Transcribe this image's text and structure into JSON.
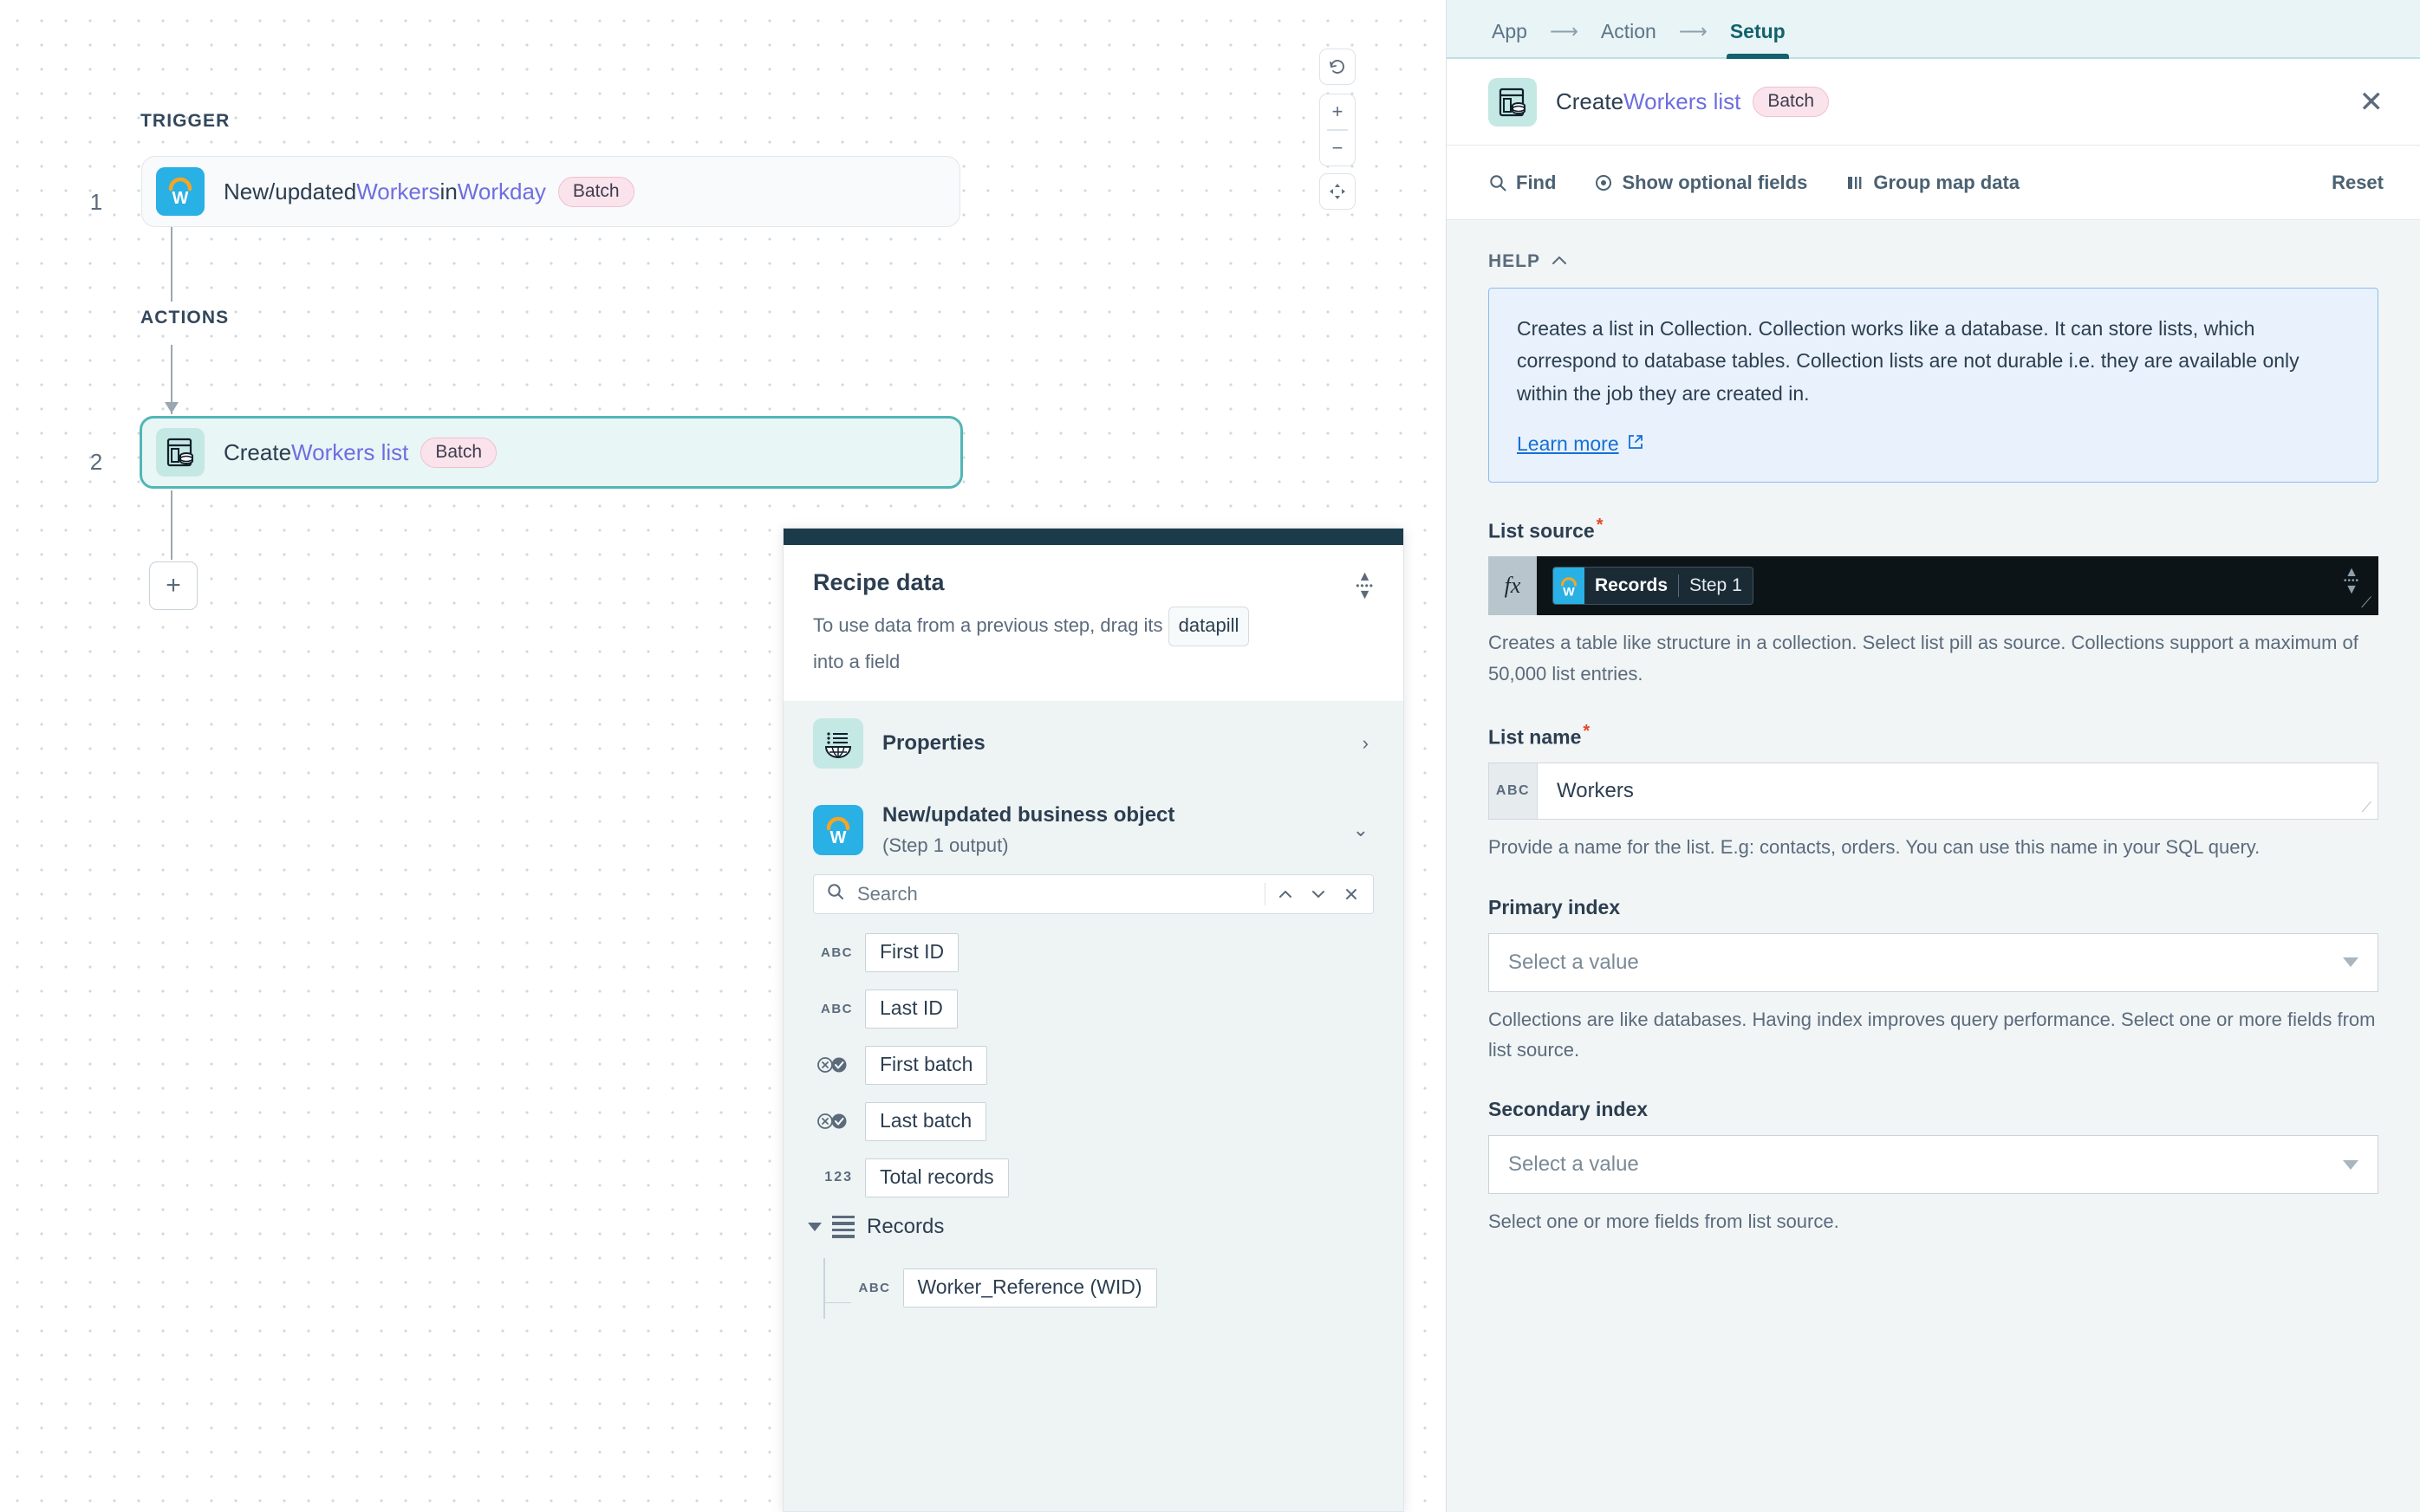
{
  "canvas": {
    "trigger_label": "TRIGGER",
    "actions_label": "ACTIONS",
    "step1": {
      "number": "1",
      "text_pre": "New/updated ",
      "accent1": "Workers",
      "text_mid": " in ",
      "accent2": "Workday",
      "badge": "Batch",
      "icon": "workday-icon"
    },
    "step2": {
      "number": "2",
      "text_pre": "Create ",
      "accent1": "Workers list",
      "badge": "Batch",
      "icon": "collection-icon"
    },
    "add_step_label": "+",
    "controls": {
      "reset": "↺",
      "zoom_in": "+",
      "zoom_out": "−",
      "fit": "fit-to-screen"
    }
  },
  "recipe_panel": {
    "title": "Recipe data",
    "subtitle_pre": "To use data from a previous step, drag its ",
    "chip": "datapill",
    "subtitle_post": "into a field",
    "rows": [
      {
        "title": "Properties",
        "sub": "",
        "icon": "properties-icon",
        "chevron": "›"
      },
      {
        "title": "New/updated business object",
        "sub": "(Step 1 output)",
        "icon": "workday-icon",
        "chevron": "⌄"
      }
    ],
    "search_placeholder": "Search",
    "pills": [
      {
        "type": "ABC",
        "label": "First ID"
      },
      {
        "type": "ABC",
        "label": "Last ID"
      },
      {
        "type": "BOOL",
        "label": "First batch"
      },
      {
        "type": "BOOL",
        "label": "Last batch"
      },
      {
        "type": "123",
        "label": "Total records"
      }
    ],
    "records_label": "Records",
    "nested_pill": {
      "type": "ABC",
      "label": "Worker_Reference (WID)"
    }
  },
  "right_panel": {
    "tabs": [
      {
        "label": "App",
        "active": false
      },
      {
        "label": "Action",
        "active": false
      },
      {
        "label": "Setup",
        "active": true
      }
    ],
    "tab_arrow": "⟶",
    "header": {
      "text_pre": "Create ",
      "accent": "Workers list",
      "badge": "Batch",
      "close": "✕"
    },
    "toolbar": {
      "find": "Find",
      "show_optional": "Show optional fields",
      "group_map": "Group map data",
      "reset": "Reset"
    },
    "help": {
      "label": "HELP",
      "body": "Creates a list in Collection. Collection works like a database. It can store lists, which correspond to database tables. Collection lists are not durable i.e. they are available only within the job they are created in.",
      "link": "Learn more"
    },
    "fields": {
      "list_source": {
        "label": "List source",
        "required": true,
        "fx": "fx",
        "pill_name": "Records",
        "pill_step": "Step 1",
        "hint": "Creates a table like structure in a collection. Select list pill as source. Collections support a maximum of 50,000 list entries."
      },
      "list_name": {
        "label": "List name",
        "required": true,
        "type_tag": "ABC",
        "value": "Workers",
        "hint": "Provide a name for the list. E.g: contacts, orders. You can use this name in your SQL query."
      },
      "primary_index": {
        "label": "Primary index",
        "required": false,
        "placeholder": "Select a value",
        "hint": "Collections are like databases. Having index improves query performance. Select one or more fields from list source."
      },
      "secondary_index": {
        "label": "Secondary index",
        "required": false,
        "placeholder": "Select a value",
        "hint": "Select one or more fields from list source."
      }
    }
  },
  "colors": {
    "accent_purple": "#6e6ee0",
    "teal_selected": "#52b6b6",
    "batch_pink": "#fbe3ec",
    "help_blue": "#e8f1fc",
    "link_blue": "#1570d6",
    "tab_active": "#11626e"
  }
}
